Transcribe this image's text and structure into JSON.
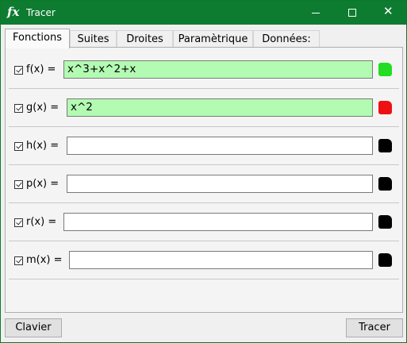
{
  "window": {
    "title": "Tracer",
    "app_icon_text": "fx"
  },
  "tabs": [
    {
      "label": "Fonctions",
      "active": true
    },
    {
      "label": "Suites",
      "active": false
    },
    {
      "label": "Droites",
      "active": false
    },
    {
      "label": "Paramètrique",
      "active": false
    },
    {
      "label": "Données:",
      "active": false
    }
  ],
  "functions": [
    {
      "checked": true,
      "label": "f(x) =",
      "value": "x^3+x^2+x",
      "color": "#22dd22"
    },
    {
      "checked": true,
      "label": "g(x) =",
      "value": "x^2",
      "color": "#ee1111"
    },
    {
      "checked": true,
      "label": "h(x) =",
      "value": "",
      "color": "#000000"
    },
    {
      "checked": true,
      "label": "p(x) =",
      "value": "",
      "color": "#000000"
    },
    {
      "checked": true,
      "label": "r(x) =",
      "value": "",
      "color": "#000000"
    },
    {
      "checked": true,
      "label": "m(x) =",
      "value": "",
      "color": "#000000"
    }
  ],
  "buttons": {
    "keyboard": "Clavier",
    "plot": "Tracer"
  },
  "colors": {
    "titlebar": "#0e7c30",
    "filled_input": "#b3fab3"
  }
}
